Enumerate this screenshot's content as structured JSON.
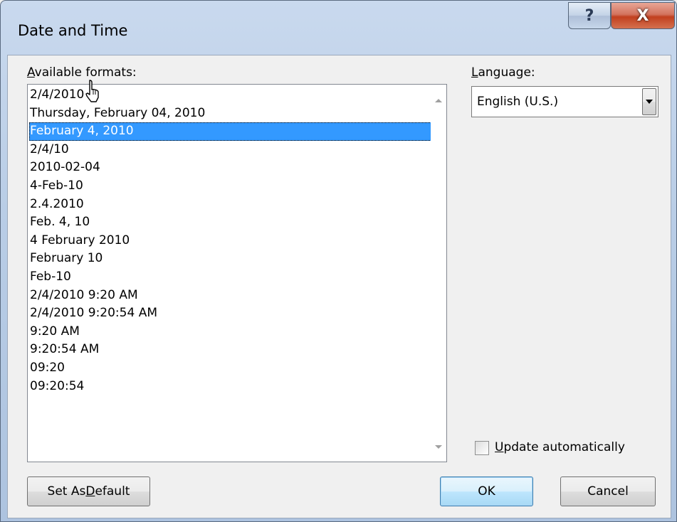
{
  "window": {
    "title": "Date and Time",
    "help_glyph": "?",
    "close_glyph": "X"
  },
  "formats": {
    "label_hotkey": "A",
    "label_rest": "vailable formats:",
    "items": [
      "2/4/2010",
      "Thursday, February 04, 2010",
      "February 4, 2010",
      "2/4/10",
      "2010-02-04",
      "4-Feb-10",
      "2.4.2010",
      "Feb. 4, 10",
      "4 February 2010",
      "February 10",
      "Feb-10",
      "2/4/2010 9:20 AM",
      "2/4/2010 9:20:54 AM",
      "9:20 AM",
      "9:20:54 AM",
      "09:20",
      "09:20:54"
    ],
    "selected_index": 2
  },
  "language": {
    "label_hotkey": "L",
    "label_rest": "anguage:",
    "selected_value": "English (U.S.)"
  },
  "update_automatically": {
    "label_hotkey": "U",
    "label_rest": "pdate automatically",
    "checked": false
  },
  "buttons": {
    "set_default_prefix": "Set As ",
    "set_default_hotkey": "D",
    "set_default_suffix": "efault",
    "ok": "OK",
    "cancel": "Cancel"
  },
  "icons": {
    "help": "question-mark-icon",
    "close": "close-icon",
    "dropdown": "chevron-down-icon",
    "cursor": "mouse-pointer-icon"
  }
}
